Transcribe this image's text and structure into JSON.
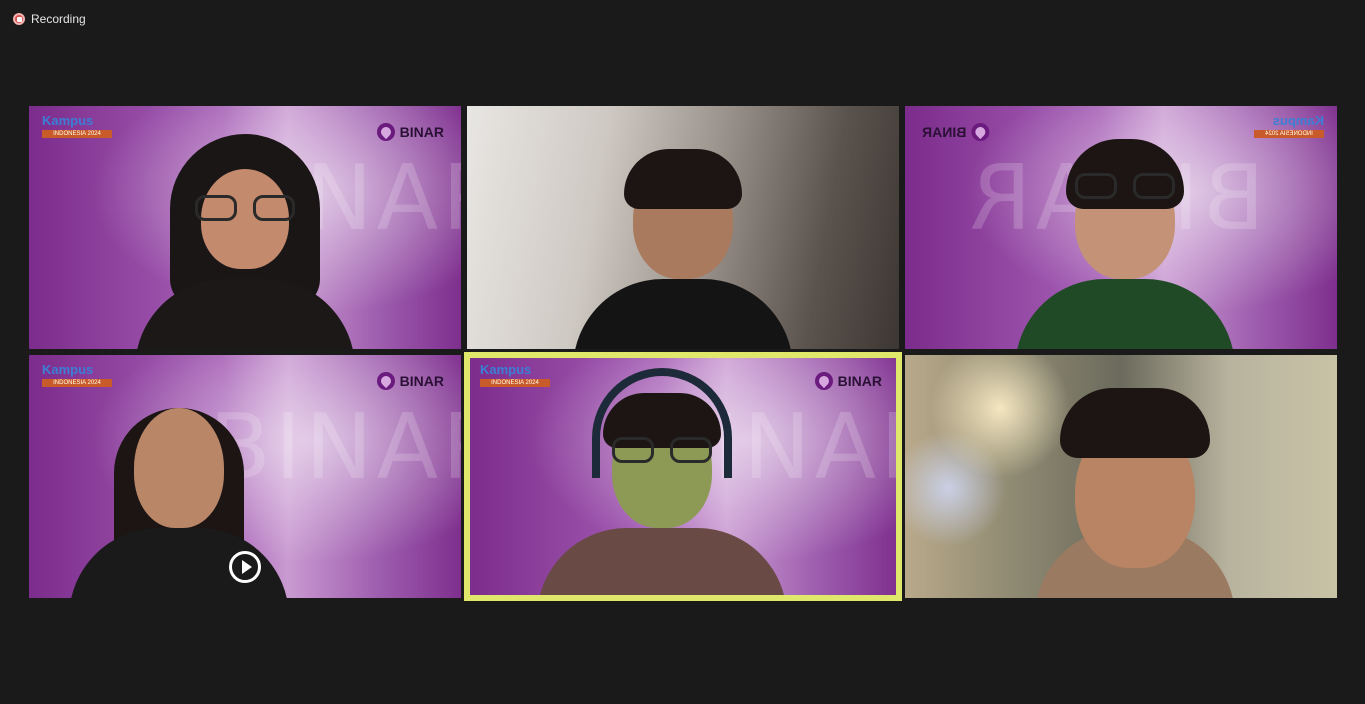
{
  "status": {
    "recording_label": "Recording",
    "recording_color": "#d9534f"
  },
  "tiles": [
    {
      "background": "virtual-binar-purple",
      "brand_label": "BINAR",
      "event_title": "Kampus",
      "event_subtitle": "INDONESIA 2024",
      "speaking": false
    },
    {
      "background": "camera-room",
      "speaking": false
    },
    {
      "background": "virtual-binar-purple-mirrored",
      "brand_label": "BINAR",
      "event_title": "Kampus",
      "event_subtitle": "INDONESIA 2024",
      "speaking": false
    },
    {
      "background": "virtual-binar-purple",
      "brand_label": "BINAR",
      "event_title": "Kampus",
      "event_subtitle": "INDONESIA 2024",
      "speaking": false,
      "overlay_icon": "play-circle-icon"
    },
    {
      "background": "virtual-binar-purple",
      "brand_label": "BINAR",
      "event_title": "Kampus",
      "event_subtitle": "INDONESIA 2024",
      "speaking": true
    },
    {
      "background": "camera-cafe",
      "speaking": false
    }
  ],
  "colors": {
    "app_background": "#1a1a1a",
    "active_speaker_border": "#dfe86a",
    "brand_purple": "#6a1b7d"
  },
  "watermark_text": "BINAR"
}
